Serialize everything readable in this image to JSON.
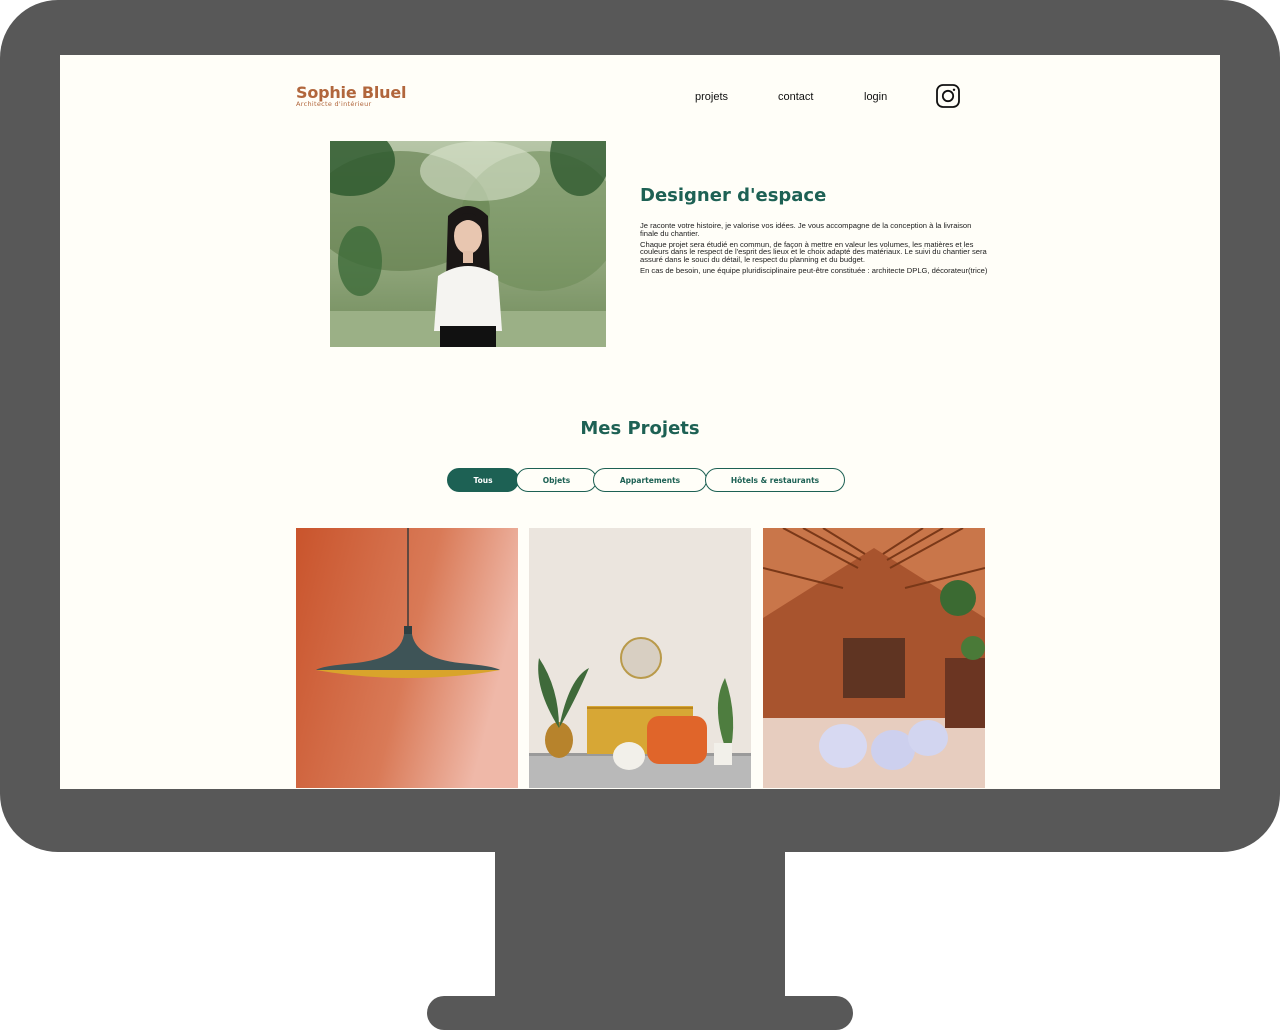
{
  "header": {
    "logo_title": "Sophie Bluel",
    "logo_subtitle": "Architecte d'intérieur",
    "nav": [
      "projets",
      "contact",
      "login"
    ],
    "instagram_icon": "instagram-icon"
  },
  "intro": {
    "title": "Designer d'espace",
    "paragraphs": [
      "Je raconte votre histoire, je valorise vos idées. Je vous accompagne de la conception à la livraison finale du chantier.",
      "Chaque projet sera étudié en commun, de façon à mettre en valeur les volumes, les matières et les couleurs dans le respect de l'esprit des lieux et le choix adapté des matériaux. Le suivi du chantier sera assuré dans le souci du détail, le respect du planning et du budget.",
      "En cas de besoin, une équipe pluridisciplinaire peut-être constituée : architecte DPLG, décorateur(trice)"
    ]
  },
  "projects": {
    "title": "Mes Projets",
    "filters": [
      "Tous",
      "Objets",
      "Appartements",
      "Hôtels & restaurants"
    ],
    "active_filter": "Tous"
  },
  "colors": {
    "brand_orange": "#B1663C",
    "brand_green": "#1D6154",
    "page_background": "#FFFEF8",
    "frame": "#585858"
  }
}
